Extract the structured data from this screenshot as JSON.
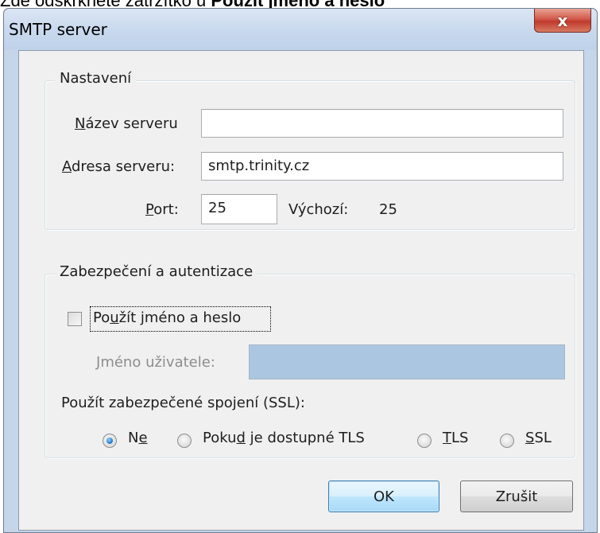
{
  "caption": {
    "prefix": "Zde odškrkněte zatržítko u ",
    "bold": "Použít jméno a heslo"
  },
  "window": {
    "title": "SMTP server",
    "close_label": "x"
  },
  "settings": {
    "legend": "Nastavení",
    "server_name": {
      "label_first": "N",
      "label_rest": "ázev serveru",
      "value": ""
    },
    "server_address": {
      "label_first": "A",
      "label_rest": "dresa serveru:",
      "value": "smtp.trinity.cz"
    },
    "port": {
      "label_first": "P",
      "label_rest": "ort:",
      "value": "25",
      "default_label": "Výchozí:",
      "default_value": "25"
    }
  },
  "security": {
    "legend": "Zabezpečení a autentizace",
    "use_credentials": {
      "label_a": "Po",
      "label_u": "u",
      "label_b": "žít jméno a heslo",
      "checked": false
    },
    "username": {
      "label_first": "J",
      "label_rest": "méno uživatele:",
      "value": ""
    },
    "ssl_heading": "Použít zabezpečené spojení (SSL):",
    "ssl_options": [
      {
        "pre": "N",
        "u": "e",
        "post": "",
        "checked": true
      },
      {
        "pre": "Poku",
        "u": "d",
        "post": " je dostupné TLS",
        "checked": false
      },
      {
        "pre": "",
        "u": "T",
        "post": "LS",
        "checked": false
      },
      {
        "pre": "",
        "u": "S",
        "post": "SL",
        "checked": false
      }
    ]
  },
  "buttons": {
    "ok": "OK",
    "cancel": "Zrušit"
  }
}
